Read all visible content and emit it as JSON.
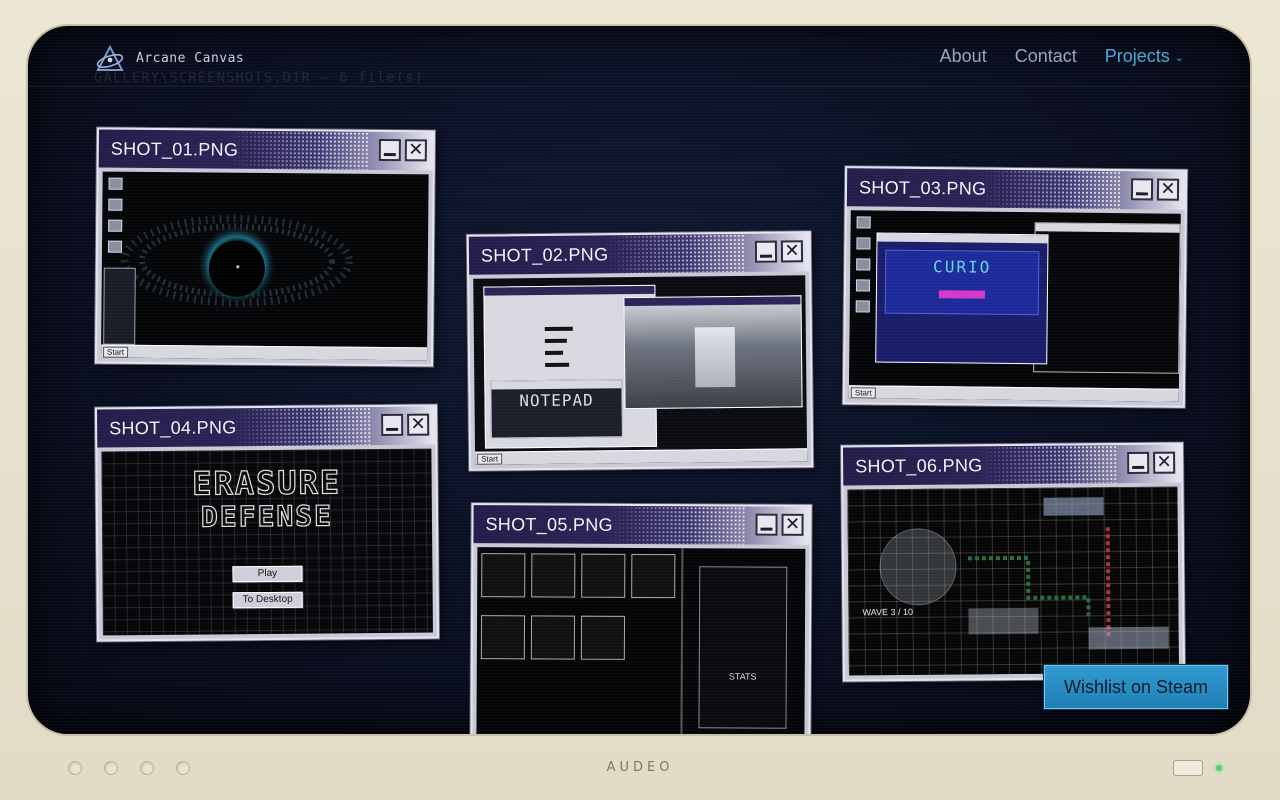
{
  "brand": {
    "name": "Arcane Canvas",
    "ghost_text": "GALLERY\\SCREENSHOTS.DIR — 6 file(s)"
  },
  "nav": {
    "links": [
      {
        "label": "About"
      },
      {
        "label": "Contact"
      },
      {
        "label": "Projects",
        "chevron": "chevron-down-icon"
      }
    ]
  },
  "windows": [
    {
      "title": "SHOT_01.PNG",
      "taskbar_start": "Start"
    },
    {
      "title": "SHOT_02.PNG",
      "notepad_label": "NOTEPAD",
      "taskbar_start": "Start"
    },
    {
      "title": "SHOT_03.PNG",
      "browser_title": "CURIO",
      "taskbar_start": "Start"
    },
    {
      "title": "SHOT_04.PNG",
      "game_title_1": "ERASURE",
      "game_title_2": "DEFENSE",
      "play_label": "Play",
      "desktop_label": "To Desktop"
    },
    {
      "title": "SHOT_05.PNG",
      "stats_label": "STATS"
    },
    {
      "title": "SHOT_06.PNG",
      "wave_label": "WAVE 3 / 10"
    }
  ],
  "cta": {
    "label": "Wishlist on Steam"
  },
  "monitor": {
    "brand": "AUDEO"
  },
  "colors": {
    "accent": "#4aa8d8",
    "titlebar": "#241d4a",
    "screen_bg": "#0a0f22",
    "cta": "#2f9ad0",
    "power_led": "#43d66a"
  }
}
